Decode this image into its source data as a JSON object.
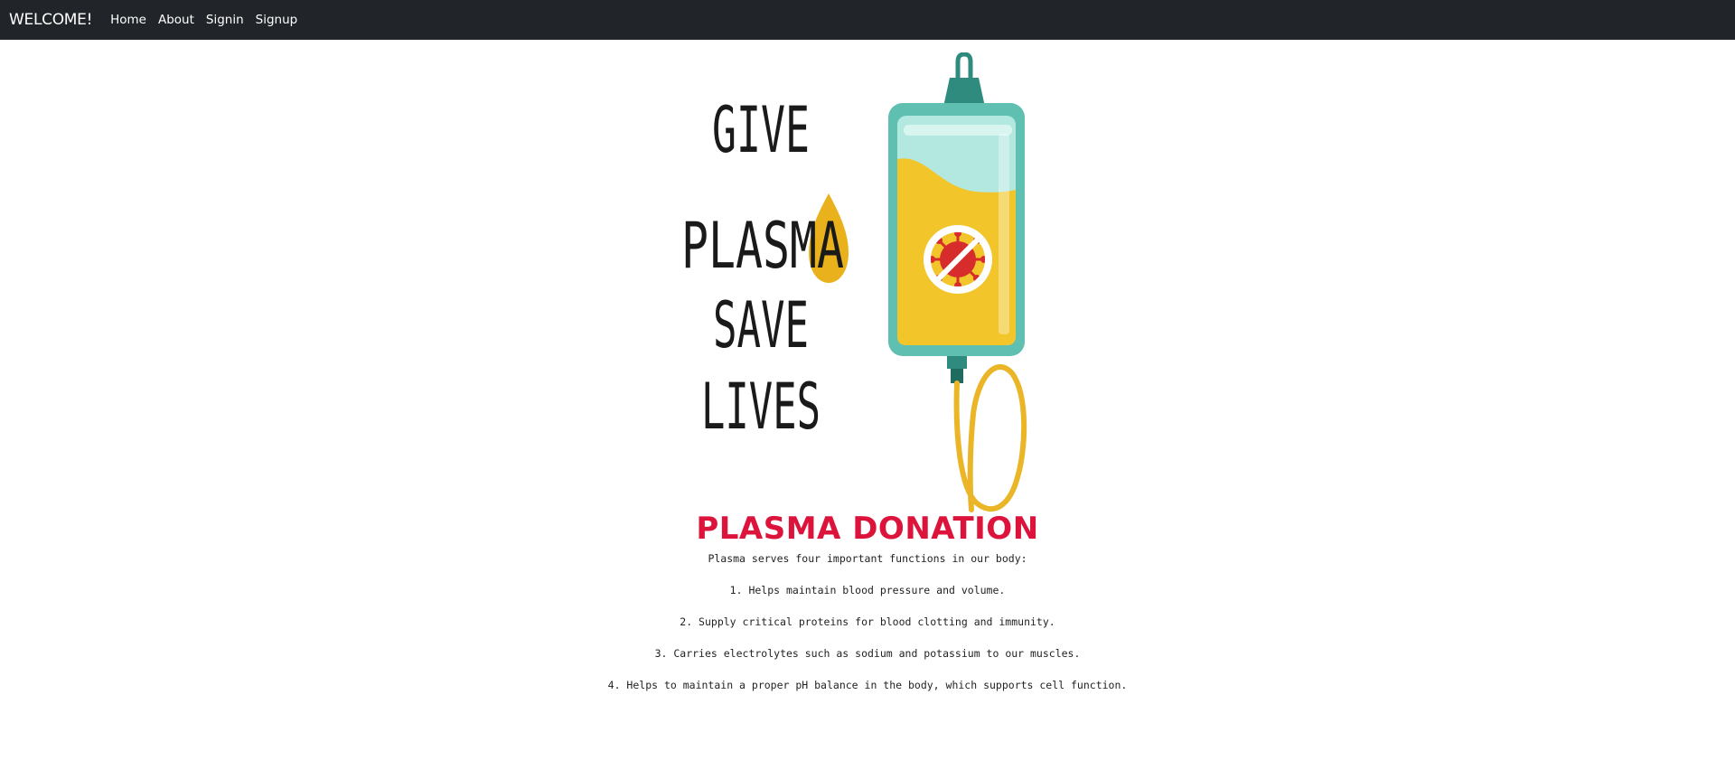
{
  "navbar": {
    "brand": "WELCOME!",
    "links": [
      "Home",
      "About",
      "Signin",
      "Signup"
    ]
  },
  "hero": {
    "lines": [
      "GIVE",
      "PLASMA",
      "SAVE",
      "LIVES"
    ],
    "colors": {
      "bag": "#5fbfb0",
      "bag_dark": "#2e8b7e",
      "fluid": "#f2c62b",
      "drop": "#e9b21c",
      "tube": "#eab526",
      "virus": "#d62c2c"
    },
    "icons": [
      "plasma-bag-icon",
      "virus-prohibited-icon",
      "drop-icon",
      "tube-icon"
    ]
  },
  "main": {
    "title": "PLASMA DONATION",
    "intro": "Plasma serves four important functions in our body:",
    "items": [
      "1. Helps maintain blood pressure and volume.",
      "2. Supply critical proteins for blood clotting and immunity.",
      "3. Carries electrolytes such as sodium and potassium to our muscles.",
      "4. Helps to maintain a proper pH balance in the body, which supports cell function."
    ]
  }
}
